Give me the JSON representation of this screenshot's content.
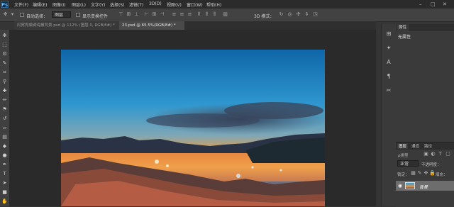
{
  "app": {
    "logo": "Ps"
  },
  "menubar": {
    "items": [
      "文件(F)",
      "编辑(E)",
      "图像(I)",
      "图层(L)",
      "文字(Y)",
      "选择(S)",
      "滤镜(T)",
      "3D(D)",
      "视图(V)",
      "窗口(W)",
      "帮助(H)"
    ],
    "window_controls": [
      "–",
      "□",
      "✕"
    ]
  },
  "options": {
    "auto_select_label": "自动选择：",
    "auto_select_value": "图层",
    "show_transform_label": "显示变换控件",
    "mode_3d_label": "3D 模式："
  },
  "doc_tabs": [
    {
      "label": "闪霓霓偏调海报背景.psd @ 112% (图层 0, RGB/8#) *",
      "active": false
    },
    {
      "label": "23.psd @ 65.5%(RGB/8#) *",
      "active": true
    }
  ],
  "properties_panel": {
    "tab": "属性",
    "no_properties": "无属性"
  },
  "layers_panel": {
    "tabs": [
      "图层",
      "通道",
      "路径"
    ],
    "kind_label": "ρ类型",
    "blend_mode": "正常",
    "opacity_label": "不透明度：",
    "lock_label": "锁定：",
    "fill_label": "填充：",
    "layer_name": "背景"
  }
}
